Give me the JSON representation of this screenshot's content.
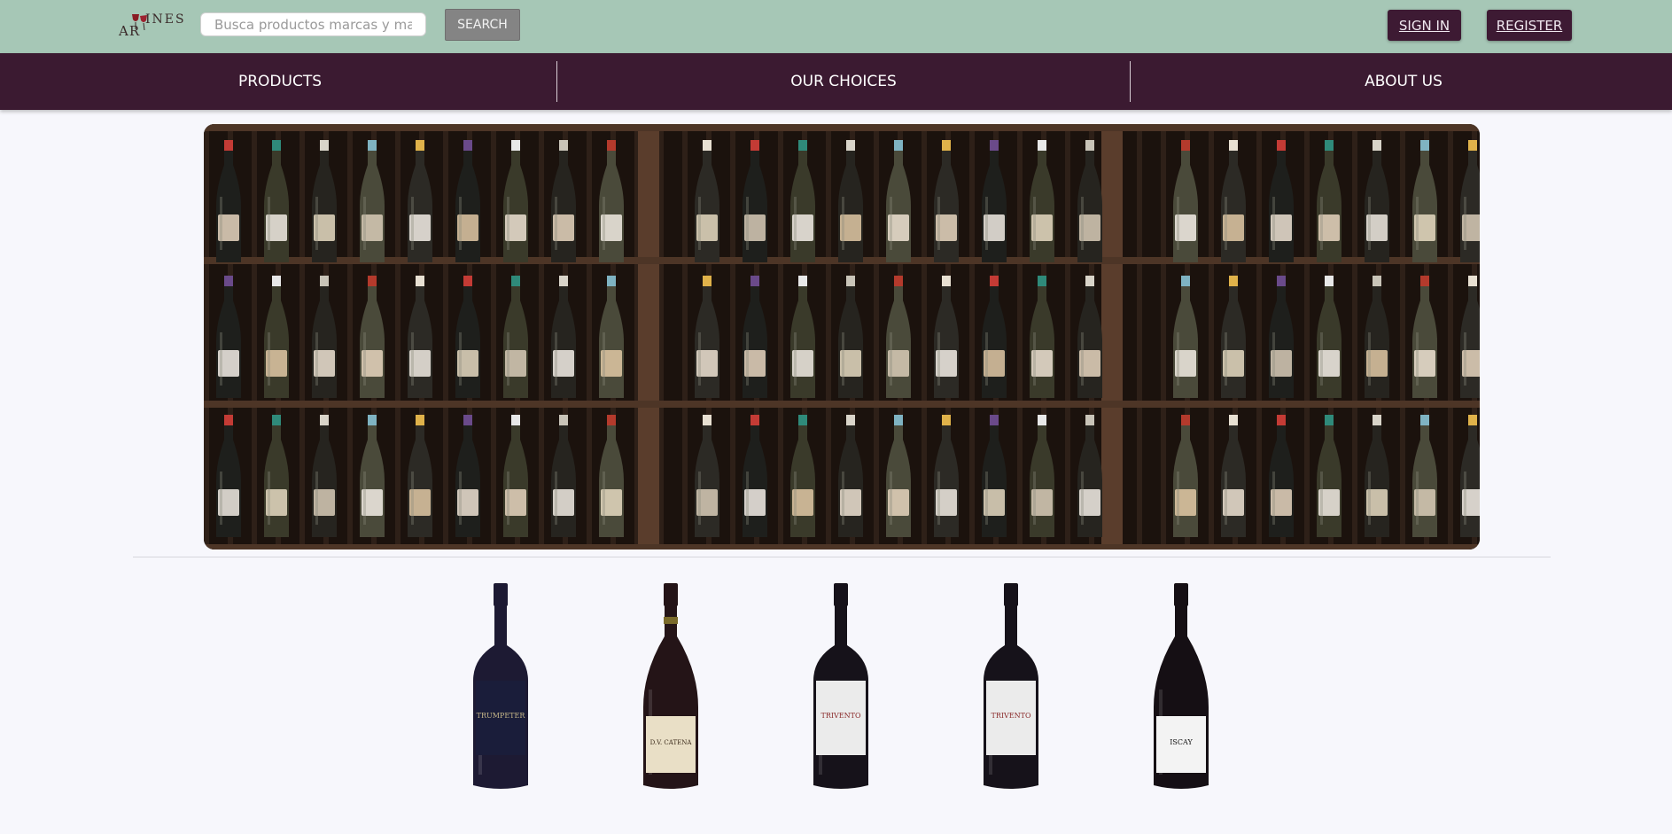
{
  "header": {
    "logo": {
      "text_top": "INES",
      "text_bottom": "AR"
    },
    "search": {
      "placeholder": "Busca productos marcas y mas...",
      "value": ""
    },
    "search_button": "SEARCH",
    "sign_in": "SIGN IN",
    "register": "REGISTER"
  },
  "nav": {
    "items": [
      {
        "label": "PRODUCTS"
      },
      {
        "label": "OUR CHOICES"
      },
      {
        "label": "ABOUT US"
      }
    ]
  },
  "hero": {
    "icon": "wine-shelf-photo"
  },
  "products": [
    {
      "label": "TRUMPETER",
      "bottle_color": "#1d1a33",
      "label_color": "#1a1d3a",
      "label_text_color": "#c9b98a"
    },
    {
      "label": "D.V. CATENA",
      "bottle_color": "#241417",
      "label_color": "#e9dfc6",
      "label_text_color": "#3a2a1a"
    },
    {
      "label": "TRIVENTO",
      "bottle_color": "#16121a",
      "label_color": "#ebebeb",
      "label_text_color": "#8a2a2a"
    },
    {
      "label": "TRIVENTO",
      "bottle_color": "#16121a",
      "label_color": "#ebebeb",
      "label_text_color": "#8a2a2a"
    },
    {
      "label": "ISCAY",
      "bottle_color": "#150f14",
      "label_color": "#f3f3f3",
      "label_text_color": "#111111"
    }
  ],
  "colors": {
    "topbar": "#a6c7b6",
    "navbar": "#3b1a31",
    "auth_button": "#3d1a33",
    "search_button": "#848484",
    "page_bg": "#f7f7fc"
  }
}
